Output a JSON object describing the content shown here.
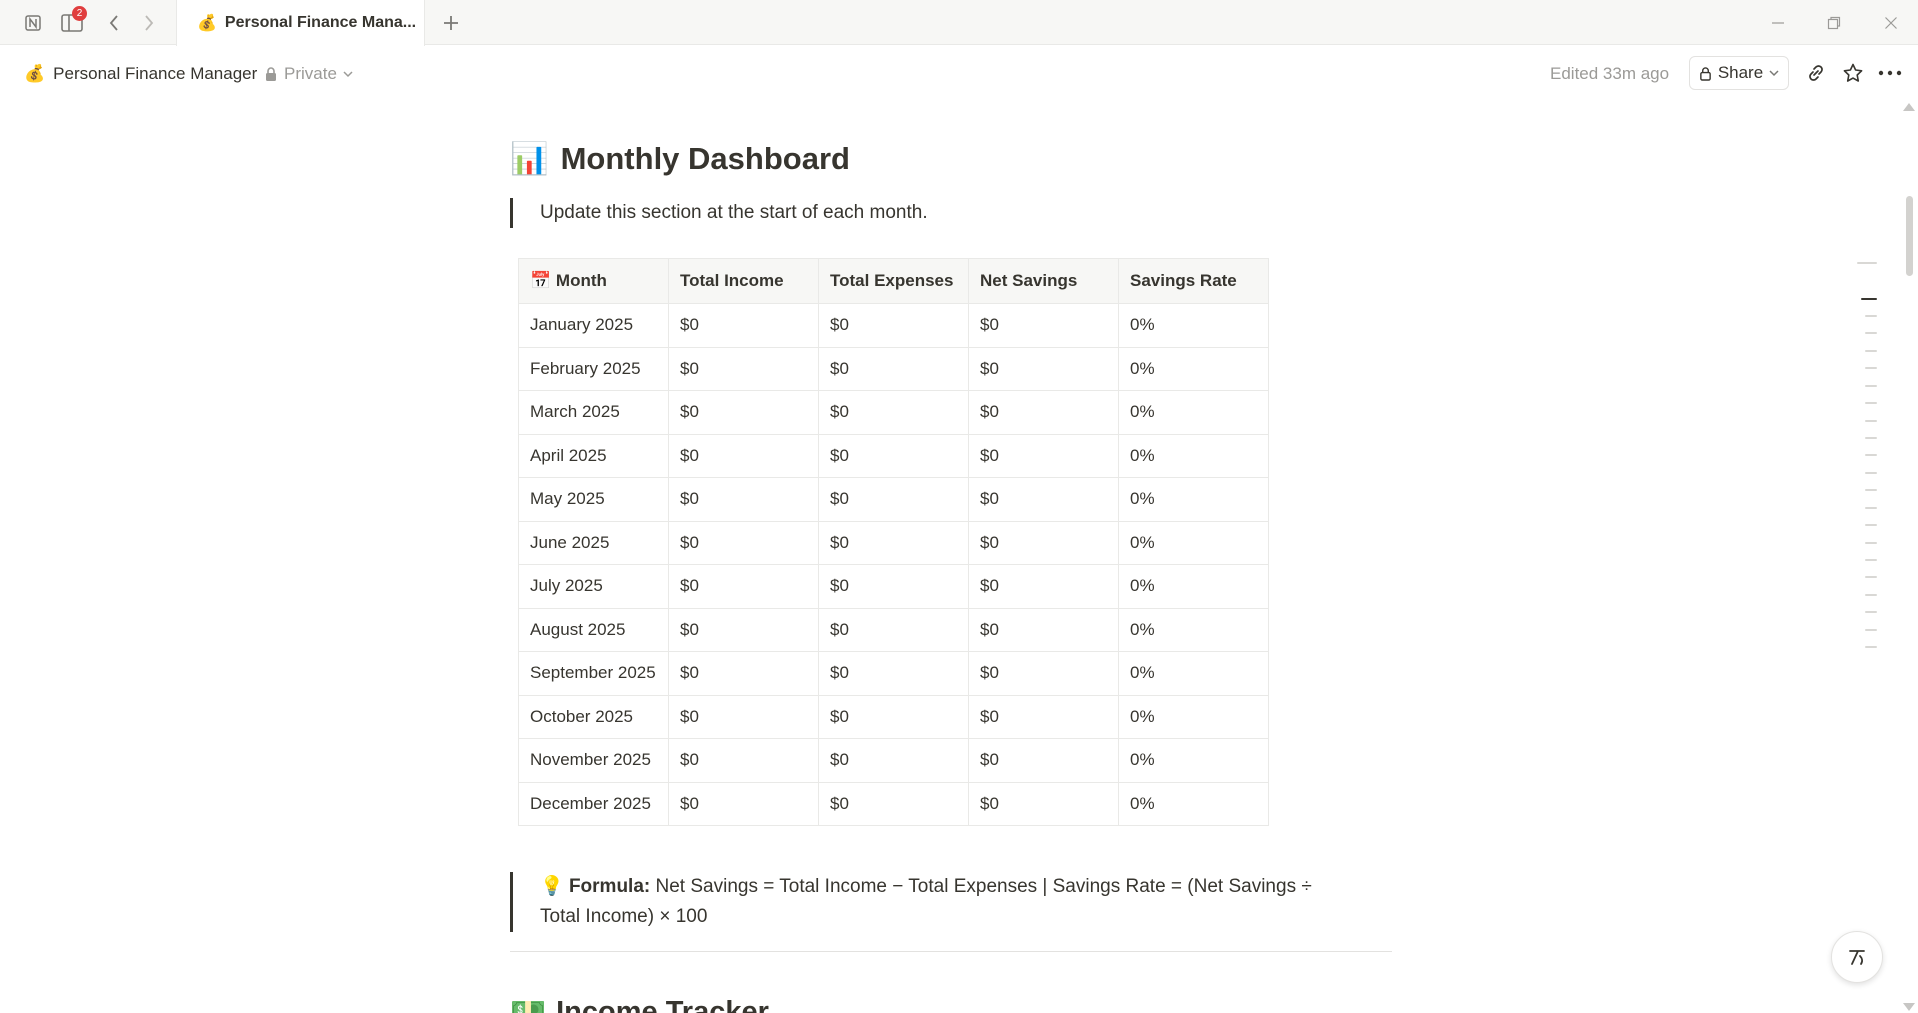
{
  "titlebar": {
    "notification_count": "2",
    "tab": {
      "emoji": "💰",
      "title": "Personal Finance Mana..."
    }
  },
  "header": {
    "page_emoji": "💰",
    "page_title": "Personal Finance Manager",
    "privacy": "Private",
    "edited": "Edited 33m ago",
    "share_label": "Share"
  },
  "content": {
    "heading_emoji": "📊",
    "heading": "Monthly Dashboard",
    "note": "Update this section at the start of each month.",
    "table": {
      "month_emoji": "📅",
      "headers": [
        "Month",
        "Total Income",
        "Total Expenses",
        "Net Savings",
        "Savings Rate"
      ],
      "rows": [
        [
          "January 2025",
          "$0",
          "$0",
          "$0",
          "0%"
        ],
        [
          "February 2025",
          "$0",
          "$0",
          "$0",
          "0%"
        ],
        [
          "March 2025",
          "$0",
          "$0",
          "$0",
          "0%"
        ],
        [
          "April 2025",
          "$0",
          "$0",
          "$0",
          "0%"
        ],
        [
          "May 2025",
          "$0",
          "$0",
          "$0",
          "0%"
        ],
        [
          "June 2025",
          "$0",
          "$0",
          "$0",
          "0%"
        ],
        [
          "July 2025",
          "$0",
          "$0",
          "$0",
          "0%"
        ],
        [
          "August 2025",
          "$0",
          "$0",
          "$0",
          "0%"
        ],
        [
          "September 2025",
          "$0",
          "$0",
          "$0",
          "0%"
        ],
        [
          "October 2025",
          "$0",
          "$0",
          "$0",
          "0%"
        ],
        [
          "November 2025",
          "$0",
          "$0",
          "$0",
          "0%"
        ],
        [
          "December 2025",
          "$0",
          "$0",
          "$0",
          "0%"
        ]
      ]
    },
    "formula": {
      "emoji": "💡",
      "label": "Formula:",
      "text": " Net Savings = Total Income − Total Expenses | Savings Rate = (Net Savings ÷ Total Income) × 100"
    },
    "next_heading_emoji": "💵",
    "next_heading": "Income Tracker"
  }
}
